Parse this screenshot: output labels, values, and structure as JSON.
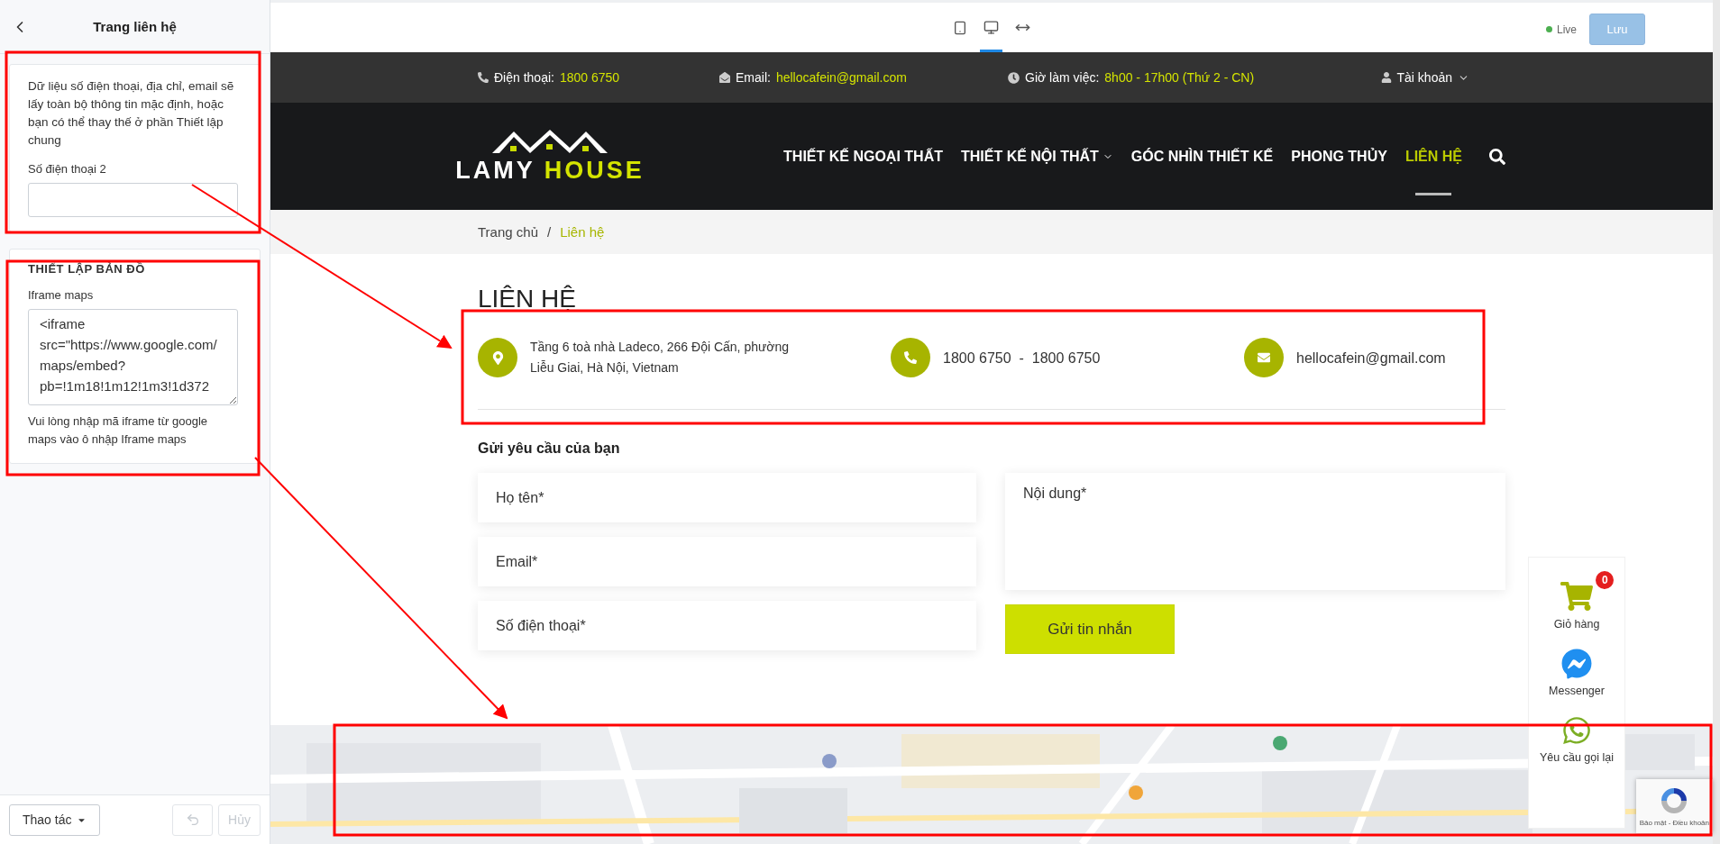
{
  "sidebar": {
    "title": "Trang liên hệ",
    "note": "Dữ liệu số điện thoại, địa chỉ, email sẽ lấy toàn bộ thông tin mặc định, hoặc bạn có thể thay thế ở phần Thiết lập chung",
    "phone2": {
      "label": "Số điện thoại 2"
    },
    "map_section": {
      "heading": "THIẾT LẬP BẢN ĐỒ",
      "label": "Iframe maps",
      "value": "<iframe src=\"https://www.google.com/maps/embed?pb=!1m18!1m12!1m3!1d372",
      "help": "Vui lòng nhập mã iframe từ google maps vào ô nhập Iframe maps"
    },
    "actions_button": "Thao tác",
    "undo": {
      "disabled": true
    },
    "cancel_button": {
      "label": "Hủy",
      "disabled": true
    }
  },
  "toolbar": {
    "devices": [
      {
        "kind": "tablet",
        "selected": false
      },
      {
        "kind": "desktop",
        "selected": true
      },
      {
        "kind": "fullwidth",
        "selected": false
      }
    ],
    "live_label": "Live",
    "save_button": {
      "label": "Lưu",
      "disabled": true
    }
  },
  "site": {
    "topbar": [
      {
        "kind": "phone",
        "label": "Điện thoại:",
        "value": "1800 6750"
      },
      {
        "kind": "email",
        "label": "Email:",
        "value": "hellocafein@gmail.com"
      },
      {
        "kind": "hours",
        "label": "Giờ làm việc:",
        "value": "8h00 - 17h00 (Thứ 2 - CN)"
      }
    ],
    "account": "Tài khoản",
    "logo": {
      "word1": "LAMY",
      "word2": "HOUSE"
    },
    "nav": [
      {
        "label": "THIẾT KẾ NGOẠI THẤT",
        "selected": false,
        "dropdown": false
      },
      {
        "label": "THIẾT KẾ NỘI THẤT",
        "selected": false,
        "dropdown": true
      },
      {
        "label": "GÓC NHÌN THIẾT KẾ",
        "selected": false,
        "dropdown": false
      },
      {
        "label": "PHONG THỦY",
        "selected": false,
        "dropdown": false
      },
      {
        "label": "LIÊN HỆ",
        "selected": true,
        "dropdown": false
      }
    ],
    "breadcrumb_separator": "/",
    "breadcrumb": [
      {
        "label": "Trang chủ",
        "selected": false
      },
      {
        "label": "Liên hệ",
        "selected": true
      }
    ],
    "page_title": "LIÊN HỆ",
    "contacts": [
      {
        "kind": "address",
        "lines": [
          "Tầng 6 toà nhà Ladeco, 266 Đội Cấn, phường",
          "Liễu Giai, Hà Nội, Vietnam"
        ]
      },
      {
        "kind": "phone",
        "lines": [
          "1800 6750  -  1800 6750"
        ]
      },
      {
        "kind": "email",
        "lines": [
          "hellocafein@gmail.com"
        ]
      }
    ],
    "form": {
      "title": "Gửi yêu cầu của bạn",
      "fields": [
        {
          "placeholder": "Họ tên*"
        },
        {
          "placeholder": "Email*"
        },
        {
          "placeholder": "Số điện thoại*"
        }
      ],
      "message": {
        "placeholder": "Nội dung*"
      },
      "submit": "Gửi tin nhắn"
    },
    "widgets": [
      {
        "kind": "cart",
        "label": "Giỏ hàng",
        "badge": "0"
      },
      {
        "kind": "messenger",
        "label": "Messenger"
      },
      {
        "kind": "call",
        "label": "Yêu cầu gọi lại"
      }
    ],
    "recaptcha": {
      "terms": "Bảo mật - Điều khoản"
    }
  }
}
